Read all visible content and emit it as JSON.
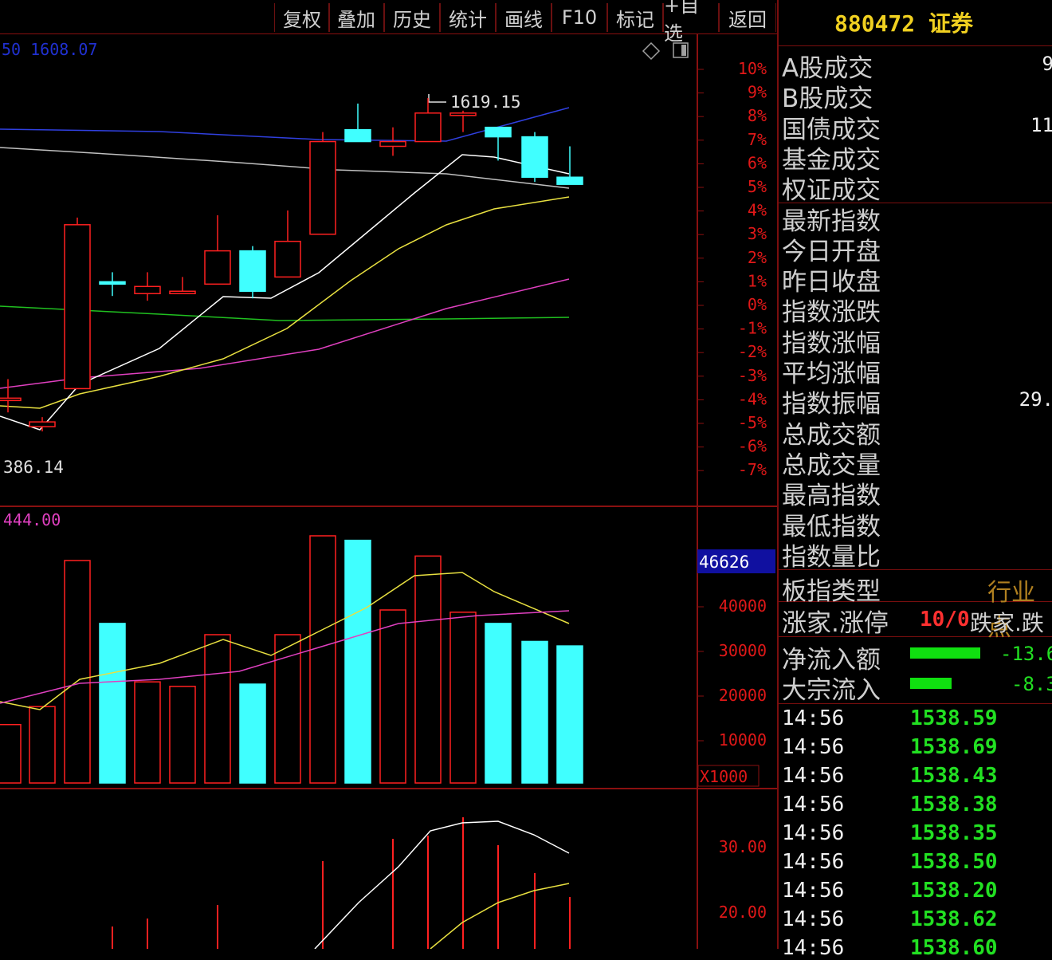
{
  "toolbar": {
    "buttons": [
      "复权",
      "叠加",
      "历史",
      "统计",
      "画线",
      "F10",
      "标记",
      "+自选",
      "返回"
    ]
  },
  "chart": {
    "ma_readout": "50  1608.07",
    "high_label": "1619.15",
    "low_label": "386.14",
    "vol_ma_readout": "444.00",
    "vol_current": "46626",
    "vol_unit": "X1000",
    "pct_ticks": [
      "10%",
      "9%",
      "8%",
      "7%",
      "6%",
      "5%",
      "4%",
      "3%",
      "2%",
      "1%",
      "0%",
      "-1%",
      "-2%",
      "-3%",
      "-4%",
      "-5%",
      "-6%",
      "-7%"
    ],
    "vol_ticks": [
      "40000",
      "30000",
      "20000",
      "10000"
    ],
    "ind_ticks": [
      "30.00",
      "20.00"
    ],
    "colors": {
      "up": "#ff2020",
      "down": "#40ffff",
      "ma5": "#ffffff",
      "ma10": "#e8e040",
      "ma20": "#e040c0",
      "ma60": "#20c020",
      "ma120": "#3040e0"
    },
    "candles": [
      {
        "o": 1556.0,
        "c": 1556.0,
        "h": 1560.0,
        "l": 1553.0,
        "up": true
      },
      {
        "o": 1551.0,
        "c": 1550.0,
        "h": 1552.0,
        "l": 1549.0,
        "up": true
      },
      {
        "o": 1558.0,
        "c": 1592.5,
        "h": 1594.0,
        "l": 1558.0,
        "up": true
      },
      {
        "o": 1580.5,
        "c": 1580.5,
        "h": 1582.5,
        "l": 1577.5,
        "up": false
      },
      {
        "o": 1578.0,
        "c": 1579.5,
        "h": 1582.5,
        "l": 1576.5,
        "up": true
      },
      {
        "o": 1578.0,
        "c": 1578.5,
        "h": 1581.5,
        "l": 1578.0,
        "up": true
      },
      {
        "o": 1580.0,
        "c": 1587.0,
        "h": 1594.5,
        "l": 1580.0,
        "up": true
      },
      {
        "o": 1587.0,
        "c": 1578.5,
        "h": 1588.0,
        "l": 1577.0,
        "up": false
      },
      {
        "o": 1581.5,
        "c": 1589.0,
        "h": 1595.5,
        "l": 1581.5,
        "up": true
      },
      {
        "o": 1590.5,
        "c": 1610.0,
        "h": 1612.0,
        "l": 1590.5,
        "up": true
      },
      {
        "o": 1612.5,
        "c": 1610.0,
        "h": 1618.0,
        "l": 1610.0,
        "up": false
      },
      {
        "o": 1609.0,
        "c": 1610.0,
        "h": 1613.0,
        "l": 1607.0,
        "up": true
      },
      {
        "o": 1610.0,
        "c": 1616.0,
        "h": 1619.15,
        "l": 1610.0,
        "up": true
      },
      {
        "o": 1615.5,
        "c": 1616.0,
        "h": 1616.5,
        "l": 1612.0,
        "up": true
      },
      {
        "o": 1613.0,
        "c": 1611.0,
        "h": 1613.0,
        "l": 1606.0,
        "up": false
      },
      {
        "o": 1611.0,
        "c": 1602.5,
        "h": 1612.0,
        "l": 1601.5,
        "up": false
      },
      {
        "o": 1602.5,
        "c": 1601.0,
        "h": 1609.0,
        "l": 1601.0,
        "up": false
      }
    ],
    "volumes": [
      13000,
      17000,
      49500,
      35500,
      22500,
      21500,
      33000,
      22000,
      33000,
      55000,
      54000,
      38500,
      50500,
      38000,
      35500,
      31500,
      30500
    ]
  },
  "info": {
    "code": "880472",
    "name": "证券",
    "rows": [
      {
        "label": "A股成交",
        "value": "9"
      },
      {
        "label": "B股成交",
        "value": ""
      },
      {
        "label": "国债成交",
        "value": "11"
      },
      {
        "label": "基金成交",
        "value": ""
      },
      {
        "label": "权证成交",
        "value": ""
      },
      {
        "label": "最新指数",
        "value": ""
      },
      {
        "label": "今日开盘",
        "value": ""
      },
      {
        "label": "昨日收盘",
        "value": ""
      },
      {
        "label": "指数涨跌",
        "value": ""
      },
      {
        "label": "指数涨幅",
        "value": ""
      },
      {
        "label": "平均涨幅",
        "value": ""
      },
      {
        "label": "指数振幅",
        "value": "29."
      },
      {
        "label": "总成交额",
        "value": ""
      },
      {
        "label": "总成交量",
        "value": ""
      },
      {
        "label": "最高指数",
        "value": ""
      },
      {
        "label": "最低指数",
        "value": ""
      },
      {
        "label": "指数量比",
        "value": ""
      }
    ],
    "board_type_label": "板指类型",
    "board_type_value": "行业 点",
    "limit_label": "涨家.涨停",
    "limit_value": "10/0",
    "fall_label": "跌家.跌",
    "net_inflow_label": "净流入额",
    "net_inflow_value": "-13.6",
    "block_inflow_label": "大宗流入",
    "block_inflow_value": "-8.3",
    "ticks": [
      {
        "time": "14:56",
        "price": "1538.59"
      },
      {
        "time": "14:56",
        "price": "1538.69"
      },
      {
        "time": "14:56",
        "price": "1538.43"
      },
      {
        "time": "14:56",
        "price": "1538.38"
      },
      {
        "time": "14:56",
        "price": "1538.35"
      },
      {
        "time": "14:56",
        "price": "1538.50"
      },
      {
        "time": "14:56",
        "price": "1538.20"
      },
      {
        "time": "14:56",
        "price": "1538.62"
      },
      {
        "time": "14:56",
        "price": "1538.60"
      }
    ]
  }
}
